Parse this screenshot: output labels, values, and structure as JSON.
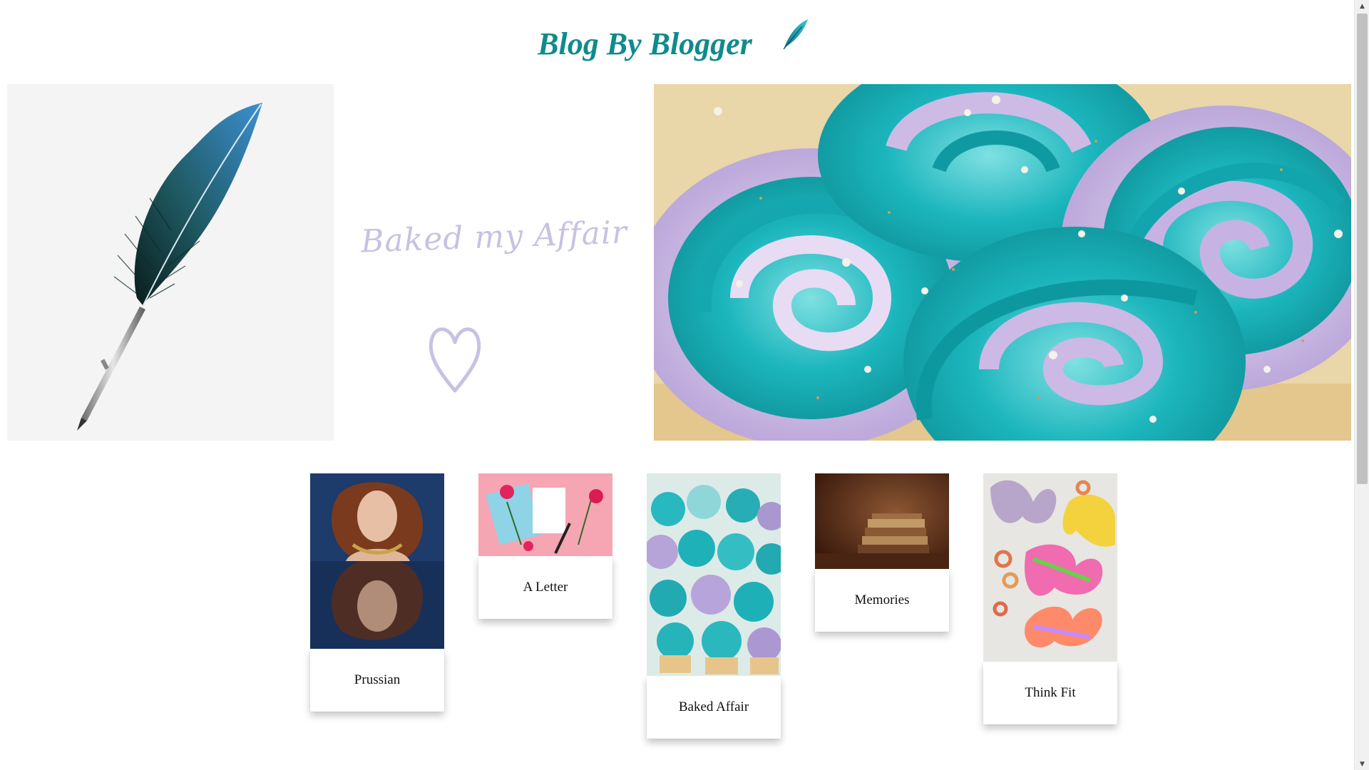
{
  "header": {
    "title": "Blog By Blogger",
    "logo_icon": "quill-icon"
  },
  "hero": {
    "brand_text": "Baked my Affair",
    "heart_icon": "heart-icon",
    "colors": {
      "title": "#0f8b8d",
      "brand_script": "#c9c1e2",
      "frosting_teal": "#1fb8bd",
      "frosting_lavender": "#b8a3d6"
    }
  },
  "cards": [
    {
      "title": "Prussian"
    },
    {
      "title": "A Letter"
    },
    {
      "title": "Baked Affair"
    },
    {
      "title": "Memories"
    },
    {
      "title": "Think Fit"
    }
  ],
  "scrollbar": {
    "up_icon": "chevron-up-icon",
    "down_icon": "chevron-down-icon"
  }
}
